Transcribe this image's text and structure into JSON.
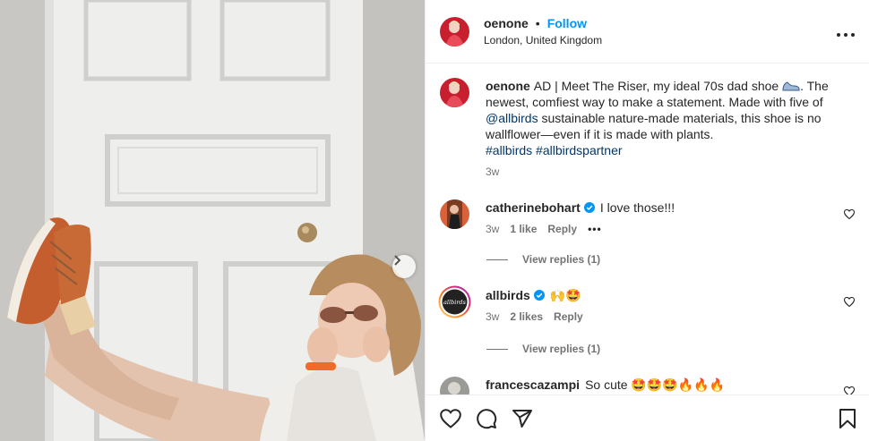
{
  "post": {
    "username": "oenone",
    "follow_label": "Follow",
    "dot": "•",
    "location": "London, United Kingdom"
  },
  "caption": {
    "username": "oenone",
    "text_1": "AD | Meet The Riser, my ideal 70s dad shoe",
    "text_2": ". The newest, comfiest way to make a statement. Made with five of",
    "mention": "@allbirds",
    "text_3": "sustainable nature-made materials, this shoe is no wallflower—even if it is made with plants.",
    "hashtags": "#allbirds #allbirdspartner",
    "time": "3w"
  },
  "comments": [
    {
      "username": "catherinebohart",
      "verified": true,
      "text": "I love those!!!",
      "time": "3w",
      "likes": "1 like",
      "reply_label": "Reply",
      "more": "•••",
      "view_replies": "View replies (1)"
    },
    {
      "username": "allbirds",
      "verified": true,
      "text": "🙌🤩",
      "time": "3w",
      "likes": "2 likes",
      "reply_label": "Reply",
      "view_replies": "View replies (1)",
      "avatar_text": "allbirds"
    },
    {
      "username": "francescazampi",
      "verified": false,
      "text": "So cute 🤩🤩🤩🔥🔥🔥"
    }
  ],
  "icons": {
    "like": "heart-icon",
    "comment": "comment-icon",
    "share": "share-icon",
    "save": "bookmark-icon",
    "more": "more-options-icon",
    "next": "chevron-right-icon",
    "verified": "verified-badge-icon"
  },
  "colors": {
    "follow": "#0095f6",
    "link": "#00376b",
    "verified": "#0095f6",
    "muted": "#737373"
  }
}
